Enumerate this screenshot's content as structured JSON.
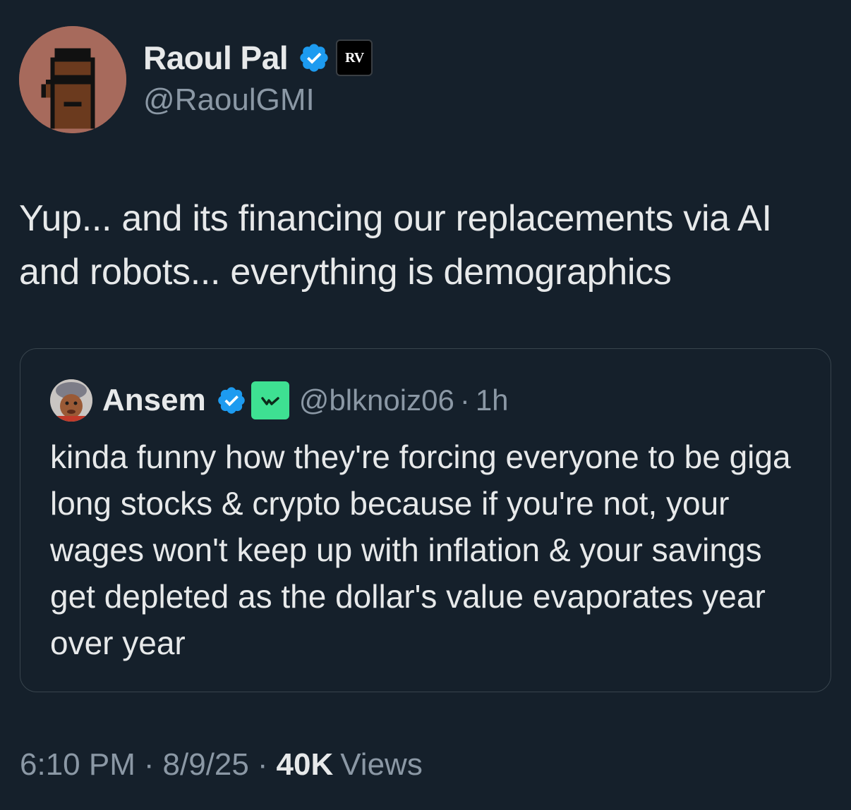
{
  "author": {
    "name": "Raoul Pal",
    "handle": "@RaoulGMI",
    "avatar_icon": "pixel-punk-avatar-icon",
    "verified_icon": "verified-badge-icon",
    "affiliation_badge_text": "RV"
  },
  "tweet": {
    "text": "Yup... and its financing our replacements via AI and robots... everything is demographics"
  },
  "quoted": {
    "name": "Ansem",
    "handle": "@blknoiz06",
    "separator": "·",
    "time": "1h",
    "verified_icon": "verified-badge-icon",
    "affiliation_icon": "green-affiliation-icon",
    "text": "kinda funny how they're forcing everyone to be giga long stocks & crypto because if you're not, your wages won't keep up with inflation & your savings get depleted as the dollar's value evaporates year over year"
  },
  "meta": {
    "time": "6:10 PM",
    "date": "8/9/25",
    "separator": "·",
    "views_count": "40K",
    "views_label": "Views"
  },
  "colors": {
    "background": "#15202b",
    "text": "#e7e9ea",
    "secondary": "#8b98a5",
    "verified": "#1d9bf0",
    "border": "#38444d",
    "affiliation_green": "#3ee092"
  }
}
